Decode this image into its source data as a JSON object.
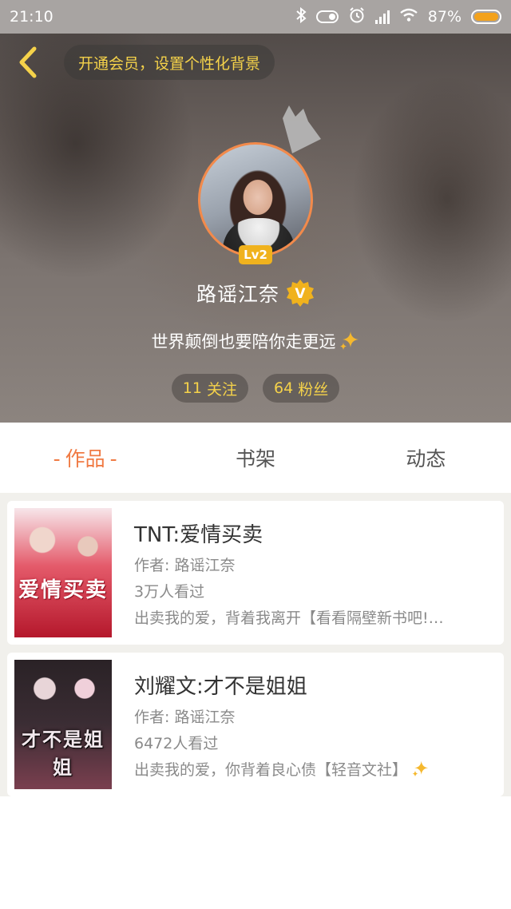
{
  "status_bar": {
    "time": "21:10",
    "battery_percent": "87%",
    "icons": [
      "bluetooth-icon",
      "toggle-icon",
      "alarm-icon",
      "signal-icon",
      "wifi-icon",
      "battery-icon"
    ]
  },
  "header": {
    "back_icon": "chevron-left-icon",
    "vip_banner": "开通会员，设置个性化背景"
  },
  "profile": {
    "level": "Lv2",
    "name": "路谣江奈",
    "verified_badge": "V",
    "signature": "世界颠倒也要陪你走更远",
    "following": {
      "count": "11",
      "label": "关注"
    },
    "followers": {
      "count": "64",
      "label": "粉丝"
    }
  },
  "tabs": [
    {
      "label": "作品",
      "active": true
    },
    {
      "label": "书架",
      "active": false
    },
    {
      "label": "动态",
      "active": false
    }
  ],
  "books": [
    {
      "title": "TNT:爱情买卖",
      "author": "作者: 路谣江奈",
      "views": "3万人看过",
      "description": "出卖我的爱，背着我离开【看看隔壁新书吧!…",
      "cover_text": "爱情买卖"
    },
    {
      "title": "刘耀文:才不是姐姐",
      "author": "作者: 路谣江奈",
      "views": "6472人看过",
      "description": "出卖我的爱，你背着良心债【轻音文社】",
      "cover_text": "才不是姐姐"
    }
  ],
  "colors": {
    "accent_orange": "#f07a43",
    "gold": "#f5d24a",
    "level_badge": "#f0b21d"
  }
}
